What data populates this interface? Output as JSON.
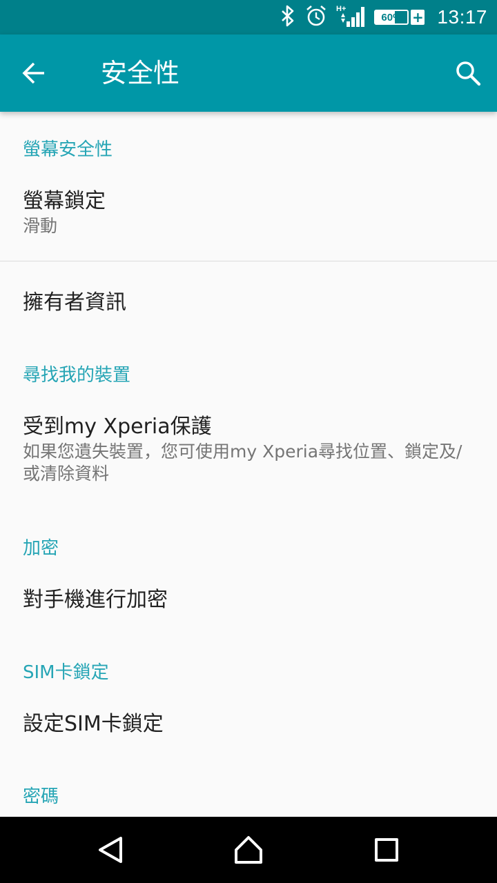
{
  "status_bar": {
    "time": "13:17",
    "battery_percent_label": "60%",
    "battery_level": 0.6,
    "network_type_label": "H+",
    "icons": [
      "bluetooth-icon",
      "alarm-icon",
      "signal-icon",
      "battery-icon"
    ]
  },
  "app_bar": {
    "title": "安全性",
    "back_icon": "arrow-left-icon",
    "search_icon": "search-icon"
  },
  "sections": {
    "screen_security": {
      "header": "螢幕安全性",
      "screen_lock": {
        "title": "螢幕鎖定",
        "summary": "滑動"
      },
      "owner_info": {
        "title": "擁有者資訊"
      }
    },
    "find_device": {
      "header": "尋找我的裝置",
      "protected": {
        "title": "受到my Xperia保護",
        "summary": "如果您遺失裝置，您可使用my Xperia尋找位置、鎖定及/或清除資料"
      }
    },
    "encryption": {
      "header": "加密",
      "encrypt_phone": {
        "title": "對手機進行加密"
      }
    },
    "sim_lock": {
      "header": "SIM卡鎖定",
      "setup": {
        "title": "設定SIM卡鎖定"
      }
    },
    "passwords": {
      "header": "密碼"
    }
  },
  "nav_bar": {
    "icons": [
      "back-triangle-icon",
      "home-icon",
      "recents-icon"
    ]
  },
  "colors": {
    "status_bar": "#00808a",
    "app_bar": "#0097a7",
    "accent": "#26a5b5",
    "background": "#fafafa"
  }
}
